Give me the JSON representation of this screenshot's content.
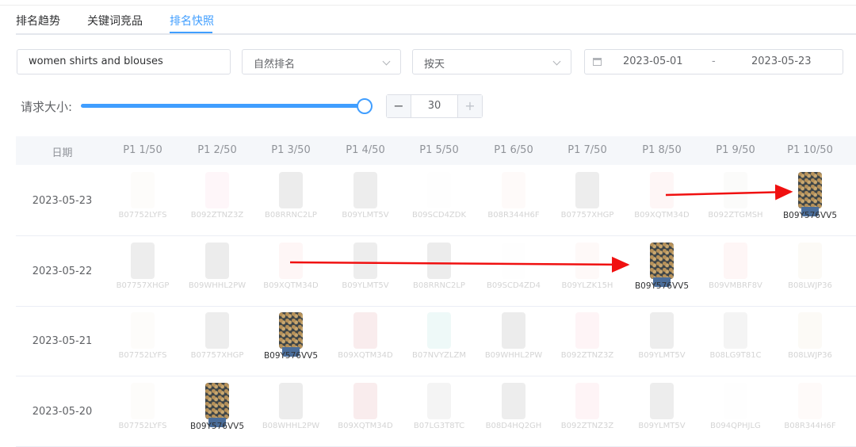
{
  "tabs": [
    {
      "label": "排名趋势",
      "active": false
    },
    {
      "label": "关键词竞品",
      "active": false
    },
    {
      "label": "排名快照",
      "active": true
    }
  ],
  "filters": {
    "keyword_value": "women shirts and blouses",
    "rank_type": "自然排名",
    "granularity": "按天",
    "date_start": "2023-05-01",
    "date_sep": "-",
    "date_end": "2023-05-23"
  },
  "request_size": {
    "label": "请求大小:",
    "value": "30",
    "slider_level": 1.0,
    "minus_label": "−",
    "plus_label": "+"
  },
  "table": {
    "date_header": "日期",
    "columns": [
      "P1 1/50",
      "P1 2/50",
      "P1 3/50",
      "P1 4/50",
      "P1 5/50",
      "P1 6/50",
      "P1 7/50",
      "P1 8/50",
      "P1 9/50",
      "P1 10/50"
    ],
    "rows": [
      {
        "date": "2023-05-23",
        "highlight": 9,
        "skus": [
          "B07752LYFS",
          "B092ZTNZ3Z",
          "B08RRNC2LP",
          "B09YLMT5V",
          "B09SCD4ZDK",
          "B08R344H6F",
          "B07757XHGP",
          "B09XQTM34D",
          "B092ZTGMSH",
          "B09Y576VV5"
        ],
        "colors": [
          "#e8d9c8",
          "#f2a0b8",
          "#2e2e2e",
          "#333333",
          "#f0f0f0",
          "#f4cdbb",
          "#3a3a3a",
          "#f09aa0",
          "#d6cfc8",
          "#3e4548"
        ]
      },
      {
        "date": "2023-05-22",
        "highlight": 7,
        "skus": [
          "B07757XHGP",
          "B09WHHL2PW",
          "B09XQTM34D",
          "B09YLMT5V",
          "B08RRNC2LP",
          "B09SCD4ZD4",
          "B09YLZK15H",
          "B09Y576VV5",
          "B09VMBRF8V",
          "B08LWJP36"
        ],
        "colors": [
          "#3a3a3a",
          "#2a2a2a",
          "#f09aa0",
          "#333333",
          "#2e2e2e",
          "#efefef",
          "#f2c2b4",
          "#3e4548",
          "#f4a0a0",
          "#d9c9a0"
        ]
      },
      {
        "date": "2023-05-21",
        "highlight": 2,
        "skus": [
          "B07752LYFS",
          "B07757XHGP",
          "B09Y576VV5",
          "B09XQTM34D",
          "B07NVYZLZM",
          "B09WHHL2PW",
          "B092ZTNZ3Z",
          "B09YLMT5V",
          "B08LG9T81C",
          "B08LWJP36"
        ],
        "colors": [
          "#e8d9c8",
          "#3a3a3a",
          "#3e4548",
          "#c0303a",
          "#48c0b0",
          "#2a2a2a",
          "#f080a0",
          "#333333",
          "#8a8a8a",
          "#d9c9a0"
        ]
      },
      {
        "date": "2023-05-20",
        "highlight": 1,
        "skus": [
          "B07752LYFS",
          "B09Y576VV5",
          "B08WHHL2PW",
          "B09XQTM34D",
          "B07LG3T8TC",
          "B08D4HQ2GH",
          "B092ZTNZ3Z",
          "B09YLMT5V",
          "B094QPHJLG",
          "B08R344H6F"
        ],
        "colors": [
          "#e8d9c8",
          "#3e4548",
          "#2a2a2a",
          "#c0303a",
          "#8a8a8a",
          "#383838",
          "#f080a0",
          "#333333",
          "#efefef",
          "#f4cdbb"
        ]
      }
    ]
  },
  "colors": {
    "accent": "#409eff",
    "arrow": "#f01010"
  }
}
